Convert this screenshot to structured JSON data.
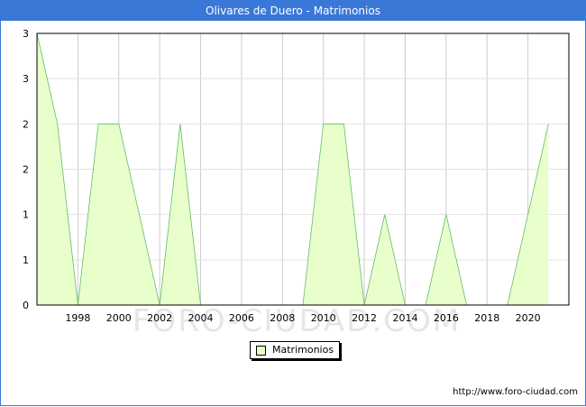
{
  "title": "Olivares de Duero - Matrimonios",
  "source": "http://www.foro-ciudad.com",
  "watermark": "FORO-CIUDAD.COM",
  "chart_data": {
    "type": "area",
    "title": "Olivares de Duero - Matrimonios",
    "xlabel": "",
    "ylabel": "",
    "x": [
      1996,
      1997,
      1998,
      1999,
      2000,
      2001,
      2002,
      2003,
      2004,
      2005,
      2006,
      2007,
      2008,
      2009,
      2010,
      2011,
      2012,
      2013,
      2014,
      2015,
      2016,
      2017,
      2018,
      2019,
      2020,
      2021
    ],
    "series": [
      {
        "name": "Matrimonios",
        "values": [
          3,
          2,
          0,
          2,
          2,
          1,
          0,
          2,
          0,
          0,
          0,
          0,
          0,
          0,
          2,
          2,
          0,
          1,
          0,
          0,
          1,
          0,
          0,
          0,
          1,
          2
        ]
      }
    ],
    "xlim": [
      1996,
      2022
    ],
    "ylim": [
      0,
      3
    ],
    "x_ticks": [
      "1998",
      "2000",
      "2002",
      "2004",
      "2006",
      "2008",
      "2010",
      "2012",
      "2014",
      "2016",
      "2018",
      "2020"
    ],
    "y_tick_labels": [
      "0",
      "1",
      "1",
      "2",
      "2",
      "3",
      "3"
    ],
    "grid": true,
    "legend": "bottom-center",
    "colors": {
      "fill": "#e8ffcc",
      "line": "#66bb66",
      "grid": "#cccccc",
      "header": "#3a78d8"
    }
  }
}
